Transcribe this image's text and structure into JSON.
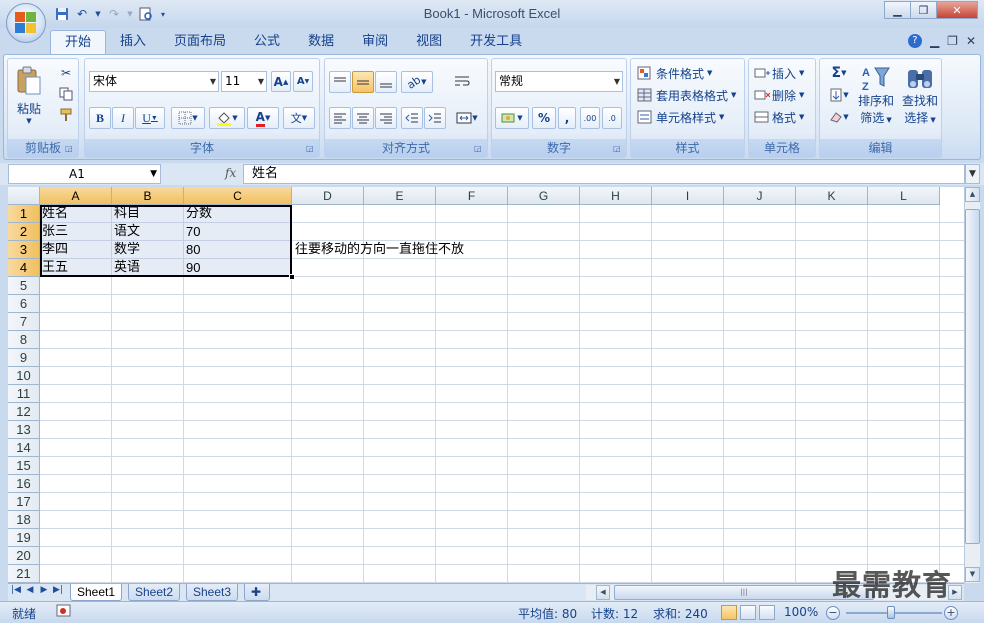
{
  "window": {
    "title": "Book1 - Microsoft Excel"
  },
  "ribbon_tabs": [
    "开始",
    "插入",
    "页面布局",
    "公式",
    "数据",
    "审阅",
    "视图",
    "开发工具"
  ],
  "ribbon": {
    "clipboard": {
      "label": "剪贴板",
      "paste": "粘贴"
    },
    "font": {
      "label": "字体",
      "font_name": "宋体",
      "font_size": "11"
    },
    "alignment": {
      "label": "对齐方式"
    },
    "number": {
      "label": "数字",
      "format": "常规"
    },
    "styles": {
      "label": "样式",
      "conditional": "条件格式",
      "table": "套用表格格式",
      "cell_styles": "单元格样式"
    },
    "cells": {
      "label": "单元格",
      "insert": "插入",
      "delete": "删除",
      "format": "格式"
    },
    "editing": {
      "label": "编辑",
      "sort_l1": "排序和",
      "sort_l2": "筛选",
      "find_l1": "查找和",
      "find_l2": "选择"
    }
  },
  "formula_bar": {
    "name_box": "A1",
    "fx": "fx",
    "content": "姓名"
  },
  "sheet": {
    "columns": [
      "A",
      "B",
      "C",
      "D",
      "E",
      "F",
      "G",
      "H",
      "I",
      "J",
      "K",
      "L"
    ],
    "rows": [
      "1",
      "2",
      "3",
      "4",
      "5",
      "6",
      "7",
      "8",
      "9",
      "10",
      "11",
      "12",
      "13",
      "14",
      "15",
      "16",
      "17",
      "18",
      "19",
      "20",
      "21"
    ],
    "cells": [
      [
        "姓名",
        "科目",
        "分数"
      ],
      [
        "张三",
        "语文",
        "70"
      ],
      [
        "李四",
        "数学",
        "80"
      ],
      [
        "王五",
        "英语",
        "90"
      ]
    ],
    "annotation": "往要移动的方向一直拖住不放"
  },
  "sheet_tabs": [
    "Sheet1",
    "Sheet2",
    "Sheet3"
  ],
  "status": {
    "mode": "就绪",
    "average": "平均值: 80",
    "count": "计数: 12",
    "sum": "求和: 240",
    "zoom": "100%"
  },
  "watermark": "最需教育",
  "colors": {
    "accent": "#15428b",
    "selection_header": "#f1c05e",
    "close_button": "#c44434"
  }
}
